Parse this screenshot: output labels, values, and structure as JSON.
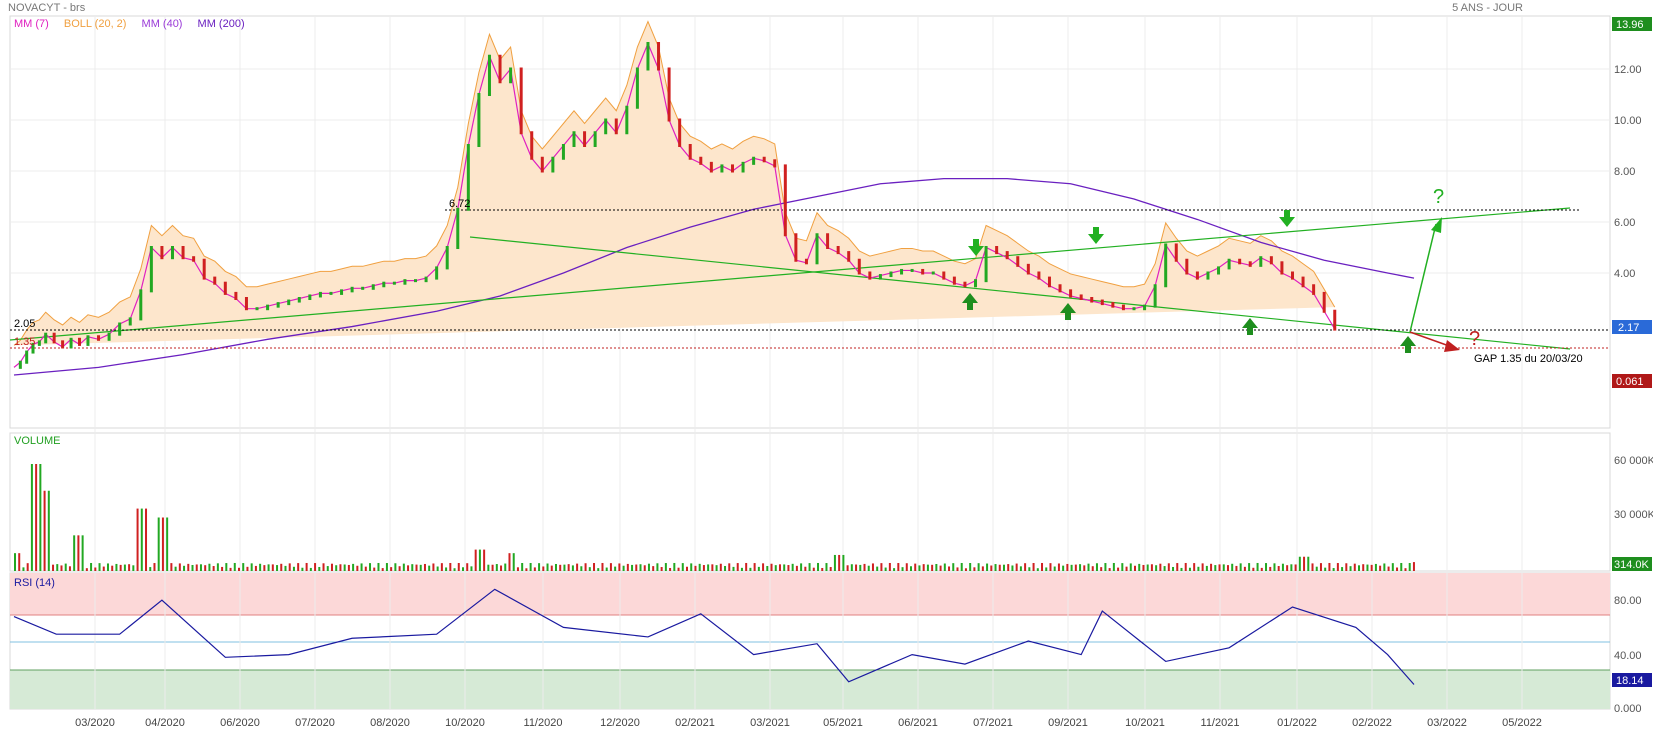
{
  "header": {
    "title": "NOVACYT - brs",
    "period": "5 ANS - JOUR"
  },
  "legend": [
    {
      "label": "MM (7)",
      "color": "#e020c0"
    },
    {
      "label": "BOLL (20, 2)",
      "color": "#f0a040"
    },
    {
      "label": "MM (40)",
      "color": "#9a3ad8"
    },
    {
      "label": "MM (200)",
      "color": "#6a20c0"
    }
  ],
  "colors": {
    "up": "#22a822",
    "down": "#d02020",
    "boll_fill": "#fde6cc",
    "trend": "#22b022",
    "ma200": "#6a20c0"
  },
  "chart_data": [
    {
      "type": "line",
      "title": "NOVACYT - brs",
      "x": [
        "03/2020",
        "04/2020",
        "06/2020",
        "07/2020",
        "08/2020",
        "10/2020",
        "11/2020",
        "12/2020",
        "02/2021",
        "03/2021",
        "05/2021",
        "06/2021",
        "07/2021",
        "09/2021",
        "10/2021",
        "11/2021",
        "01/2022",
        "02/2022",
        "03/2022",
        "05/2022"
      ],
      "ylim": [
        0,
        14
      ],
      "y_ticks": [
        "4.00",
        "6.00",
        "8.00",
        "10.00",
        "12.00"
      ],
      "price_x": [
        0,
        6,
        12,
        18,
        24,
        30,
        38,
        46,
        54,
        62,
        70,
        80,
        90,
        100,
        110,
        120,
        130,
        140,
        150,
        160,
        170,
        180,
        190,
        200,
        210,
        220,
        230,
        240,
        250,
        260,
        270,
        280,
        290,
        300,
        310,
        320,
        330,
        340,
        350,
        360,
        370,
        380,
        390,
        400,
        410,
        420,
        430,
        440,
        450,
        460,
        470,
        480,
        490,
        500,
        510,
        520,
        530,
        540,
        550,
        560,
        570,
        580,
        590,
        600,
        610,
        620,
        630,
        640,
        650,
        660,
        670,
        680,
        690,
        700,
        710,
        720,
        730,
        740,
        750,
        760,
        770,
        780,
        790,
        800,
        810,
        820,
        830,
        840,
        850,
        860,
        870,
        880,
        890,
        900,
        910,
        920,
        930,
        940,
        950,
        960,
        970,
        980,
        990,
        1000,
        1010,
        1020,
        1030,
        1040,
        1050,
        1060,
        1070,
        1080,
        1090,
        1100,
        1110,
        1120,
        1130,
        1140,
        1150,
        1160,
        1170,
        1180,
        1190,
        1200,
        1210,
        1220,
        1230,
        1240,
        1250,
        1260,
        1270,
        1280,
        1290,
        1300,
        1310,
        1320,
        1325
      ],
      "price": [
        0.3,
        0.5,
        0.9,
        1.2,
        1.3,
        1.6,
        1.3,
        1.1,
        1.4,
        1.2,
        1.5,
        1.4,
        1.6,
        2.0,
        2.2,
        3.3,
        5.0,
        4.6,
        5.0,
        4.6,
        4.5,
        3.8,
        3.6,
        3.2,
        3.0,
        2.6,
        2.6,
        2.7,
        2.8,
        2.9,
        3.0,
        3.1,
        3.2,
        3.2,
        3.3,
        3.4,
        3.4,
        3.5,
        3.6,
        3.6,
        3.7,
        3.7,
        3.8,
        4.2,
        5.0,
        6.5,
        9.0,
        11.0,
        12.5,
        11.5,
        12.0,
        9.5,
        8.5,
        8.0,
        8.5,
        9.0,
        9.5,
        9.0,
        9.5,
        10.0,
        9.5,
        10.5,
        12.0,
        13.0,
        12.0,
        10.0,
        9.0,
        8.5,
        8.3,
        8.0,
        8.2,
        8.0,
        8.3,
        8.5,
        8.4,
        8.2,
        5.5,
        4.5,
        4.4,
        5.5,
        5.0,
        4.8,
        4.5,
        4.0,
        3.8,
        3.9,
        4.0,
        4.1,
        4.1,
        4.0,
        4.0,
        3.8,
        3.6,
        3.5,
        3.7,
        5.0,
        4.8,
        4.6,
        4.3,
        4.0,
        3.8,
        3.5,
        3.3,
        3.1,
        3.0,
        2.9,
        2.8,
        2.7,
        2.6,
        2.6,
        2.7,
        3.5,
        5.1,
        4.5,
        4.0,
        3.8,
        4.0,
        4.2,
        4.5,
        4.4,
        4.3,
        4.6,
        4.4,
        4.0,
        3.8,
        3.5,
        3.2,
        2.5,
        1.8
      ],
      "ma200_x": [
        0,
        80,
        160,
        240,
        320,
        400,
        460,
        520,
        580,
        640,
        700,
        760,
        820,
        880,
        940,
        1000,
        1060,
        1120,
        1180,
        1240,
        1300,
        1325
      ],
      "ma200": [
        0.0,
        0.3,
        0.8,
        1.4,
        1.9,
        2.5,
        3.1,
        4.0,
        5.0,
        5.8,
        6.5,
        7.0,
        7.5,
        7.7,
        7.7,
        7.5,
        6.9,
        6.1,
        5.2,
        4.5,
        4.0,
        3.8
      ],
      "volume": [
        {
          "x": 0,
          "v": 10
        },
        {
          "x": 20,
          "v": 60
        },
        {
          "x": 30,
          "v": 45
        },
        {
          "x": 60,
          "v": 20
        },
        {
          "x": 120,
          "v": 35
        },
        {
          "x": 140,
          "v": 30
        },
        {
          "x": 440,
          "v": 12
        },
        {
          "x": 470,
          "v": 10
        },
        {
          "x": 780,
          "v": 9
        },
        {
          "x": 1220,
          "v": 8
        },
        {
          "x": 1325,
          "v": 5
        }
      ],
      "rsi": [
        {
          "x": 0,
          "v": 68
        },
        {
          "x": 40,
          "v": 55
        },
        {
          "x": 100,
          "v": 55
        },
        {
          "x": 140,
          "v": 80
        },
        {
          "x": 200,
          "v": 38
        },
        {
          "x": 260,
          "v": 40
        },
        {
          "x": 320,
          "v": 52
        },
        {
          "x": 400,
          "v": 55
        },
        {
          "x": 455,
          "v": 88
        },
        {
          "x": 520,
          "v": 60
        },
        {
          "x": 600,
          "v": 53
        },
        {
          "x": 650,
          "v": 70
        },
        {
          "x": 700,
          "v": 40
        },
        {
          "x": 760,
          "v": 48
        },
        {
          "x": 790,
          "v": 20
        },
        {
          "x": 850,
          "v": 40
        },
        {
          "x": 900,
          "v": 33
        },
        {
          "x": 960,
          "v": 50
        },
        {
          "x": 1010,
          "v": 40
        },
        {
          "x": 1030,
          "v": 72
        },
        {
          "x": 1090,
          "v": 35
        },
        {
          "x": 1150,
          "v": 45
        },
        {
          "x": 1210,
          "v": 75
        },
        {
          "x": 1270,
          "v": 60
        },
        {
          "x": 1300,
          "v": 40
        },
        {
          "x": 1325,
          "v": 18
        }
      ]
    }
  ],
  "volume_label": "VOLUME",
  "volume_ticks": [
    "30 000K",
    "60 000K"
  ],
  "rsi_label": "RSI (14)",
  "rsi_ticks": [
    "40.00",
    "80.00"
  ],
  "rsi_extra_tick": "0.000",
  "right_badges": {
    "top": "13.96",
    "last": "2.17",
    "low": "0.061",
    "volume_last": "314.0K",
    "rsi_last": "18.14"
  },
  "annotations": {
    "resistance": "6.72",
    "support": "2.05",
    "gap_level": "1.35",
    "gap_text": "GAP 1.35 du 20/03/20",
    "question": "?"
  }
}
